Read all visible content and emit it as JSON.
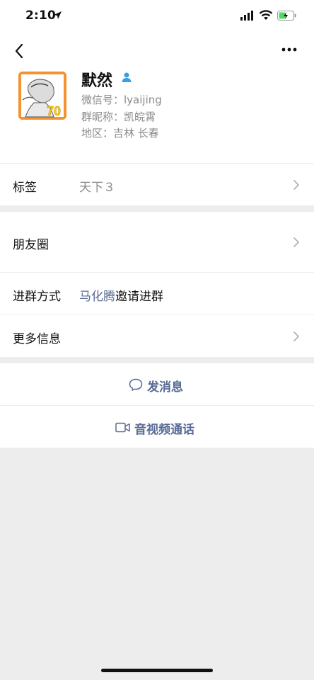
{
  "status_bar": {
    "time": "2:10",
    "icons": [
      "location-arrow-icon",
      "cellular-signal-icon",
      "wifi-icon",
      "battery-charging-icon"
    ]
  },
  "nav": {
    "back_icon": "chevron-left-icon",
    "more_icon": "more-dots-icon"
  },
  "profile": {
    "name": "默然",
    "badge_icon": "user-badge-icon",
    "wechat_id": "微信号：lyaijing",
    "group_nickname": "群昵称：凯皖霄",
    "region": "地区：吉林 长春"
  },
  "tags_row": {
    "label": "标签",
    "value": "天下３"
  },
  "moments_row": {
    "label": "朋友圈"
  },
  "join_method_row": {
    "label": "进群方式",
    "inviter": "马化腾",
    "suffix": "邀请进群"
  },
  "more_info_row": {
    "label": "更多信息"
  },
  "actions": {
    "message_label": "发消息",
    "message_icon": "chat-bubble-icon",
    "call_label": "音视频通话",
    "call_icon": "video-camera-icon"
  },
  "colors": {
    "link": "#576b95",
    "secondary_text": "#8a8a8a",
    "background": "#ededed",
    "avatar_border": "#f29230"
  }
}
